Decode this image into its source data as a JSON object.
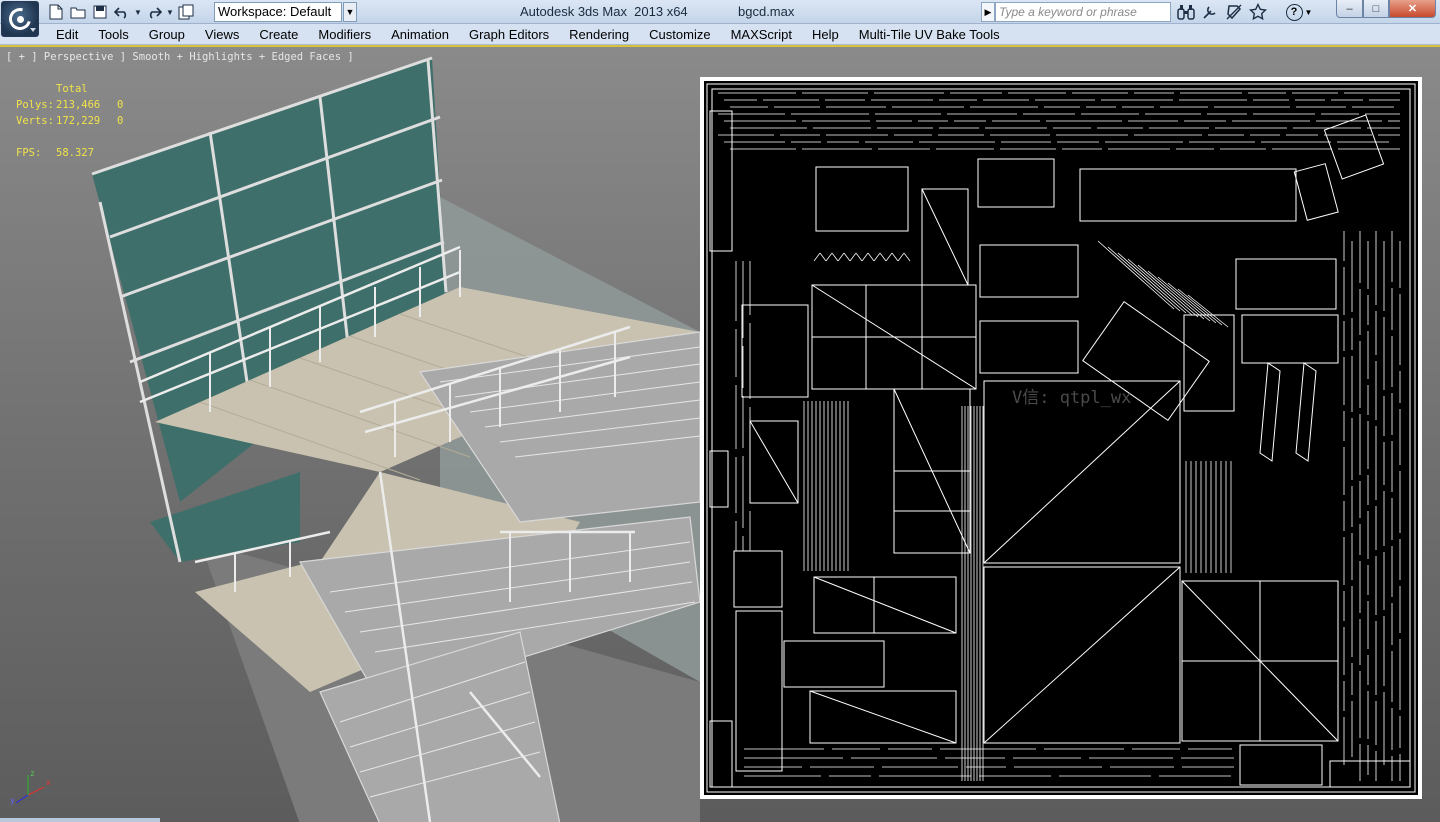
{
  "titlebar": {
    "app_icon": "3ds-max-logo-icon",
    "quick_access": [
      "new-file-icon",
      "open-file-icon",
      "save-icon",
      "undo-icon",
      "redo-icon",
      "project-folder-icon"
    ],
    "workspace_label": "Workspace: Default",
    "title": "Autodesk 3ds Max  2013 x64",
    "filename": "bgcd.max",
    "search_placeholder": "Type a keyword or phrase",
    "tools": [
      "binoculars-icon",
      "subscription-center-icon",
      "communication-center-icon",
      "favorites-star-icon"
    ],
    "help_label": "?",
    "window_controls": {
      "minimize": "–",
      "maximize": "□",
      "close": "✕"
    }
  },
  "menu": {
    "items": [
      "Edit",
      "Tools",
      "Group",
      "Views",
      "Create",
      "Modifiers",
      "Animation",
      "Graph Editors",
      "Rendering",
      "Customize",
      "MAXScript",
      "Help",
      "Multi-Tile UV Bake Tools"
    ]
  },
  "viewport": {
    "label": "[ + ] Perspective ] Smooth + Highlights + Edged Faces ]",
    "stats": {
      "header": "Total",
      "polys_label": "Polys:",
      "polys_value": "213,466",
      "polys_sel": "0",
      "verts_label": "Verts:",
      "verts_value": "172,229",
      "verts_sel": "0",
      "fps_label": "FPS:",
      "fps_value": "58.327"
    },
    "watermark": "V信: qtpl_wx",
    "axis": {
      "x": "x",
      "y": "y",
      "z": "z"
    }
  },
  "colors": {
    "title_bg": "#c4d5ea",
    "menu_bg": "#d6e2f1",
    "glass": "#3f6f6a",
    "floor": "#c9c2b0",
    "stats_yellow": "#f1e34a"
  }
}
